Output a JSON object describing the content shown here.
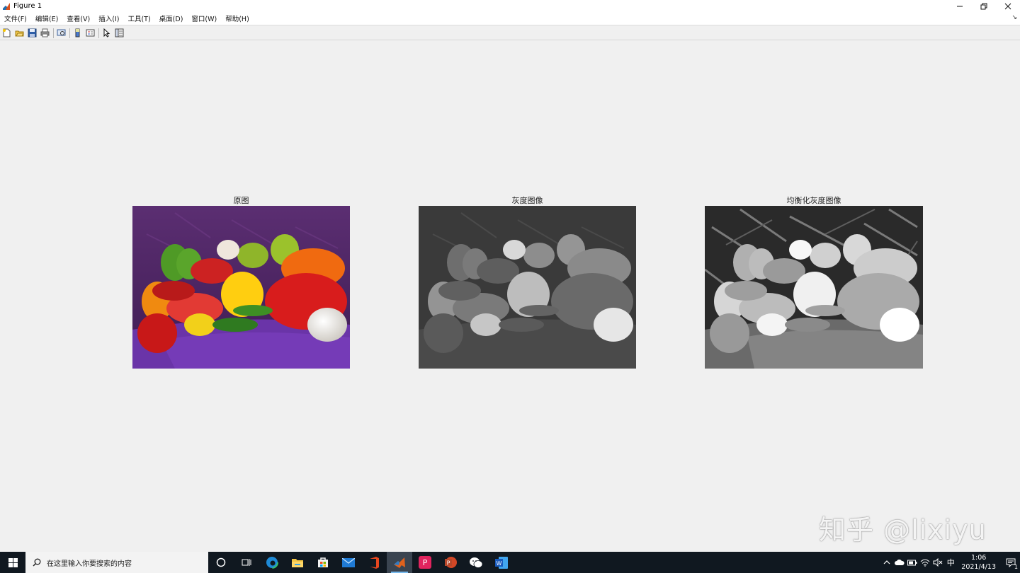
{
  "window": {
    "title": "Figure 1",
    "controls": [
      "minimize",
      "restore",
      "close"
    ]
  },
  "menubar": {
    "items": [
      "文件(F)",
      "编辑(E)",
      "查看(V)",
      "插入(I)",
      "工具(T)",
      "桌面(D)",
      "窗口(W)",
      "帮助(H)"
    ]
  },
  "toolbar": {
    "icons": [
      "new-figure-icon",
      "open-file-icon",
      "save-icon",
      "print-icon",
      "print-preview-icon",
      "colorbar-icon",
      "legend-icon",
      "pointer-icon",
      "property-editor-icon"
    ]
  },
  "figure": {
    "panels": [
      {
        "title": "原图",
        "kind": "color"
      },
      {
        "title": "灰度图像",
        "kind": "gray"
      },
      {
        "title": "均衡化灰度图像",
        "kind": "equalized"
      }
    ]
  },
  "watermark": "知乎 @lixiyu",
  "taskbar": {
    "search_placeholder": "在这里输入你要搜索的内容",
    "apps": [
      "cortana-icon",
      "task-view-icon",
      "edge-icon",
      "file-explorer-icon",
      "store-icon",
      "mail-icon",
      "office-icon",
      "matlab-icon",
      "pdf-reader-icon",
      "powerpoint-icon",
      "wechat-icon",
      "word-icon"
    ],
    "active_app": "matlab-icon",
    "tray": {
      "ime": "中",
      "time": "1:06",
      "date": "2021/4/13",
      "notifications": "1"
    }
  }
}
